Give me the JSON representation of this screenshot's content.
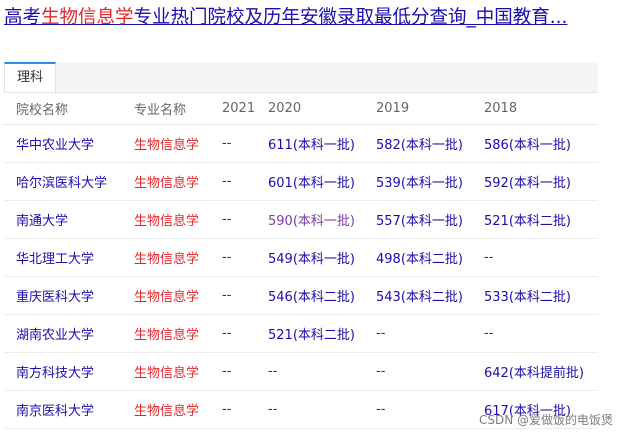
{
  "title": {
    "prefix": "高考",
    "highlight": "生物信息学",
    "suffix": "专业热门院校及历年安徽录取最低分查询_中国教育..."
  },
  "tabs": [
    {
      "label": "理科"
    }
  ],
  "table": {
    "headers": [
      "院校名称",
      "专业名称",
      "2021",
      "2020",
      "2019",
      "2018"
    ],
    "rows": [
      [
        "华中农业大学",
        "生物信息学",
        "--",
        "611(本科一批)",
        "582(本科一批)",
        "586(本科一批)"
      ],
      [
        "哈尔滨医科大学",
        "生物信息学",
        "--",
        "601(本科一批)",
        "539(本科一批)",
        "592(本科一批)"
      ],
      [
        "南通大学",
        "生物信息学",
        "--",
        "590(本科一批)",
        "557(本科一批)",
        "521(本科二批)"
      ],
      [
        "华北理工大学",
        "生物信息学",
        "--",
        "549(本科一批)",
        "498(本科二批)",
        "--"
      ],
      [
        "重庆医科大学",
        "生物信息学",
        "--",
        "546(本科二批)",
        "543(本科二批)",
        "533(本科二批)"
      ],
      [
        "湖南农业大学",
        "生物信息学",
        "--",
        "521(本科二批)",
        "--",
        "--"
      ],
      [
        "南方科技大学",
        "生物信息学",
        "--",
        "--",
        "--",
        "642(本科提前批)"
      ],
      [
        "南京医科大学",
        "生物信息学",
        "--",
        "--",
        "--",
        "617(本科一批)"
      ]
    ]
  },
  "watermark": "CSDN @爱做饭的电饭煲"
}
